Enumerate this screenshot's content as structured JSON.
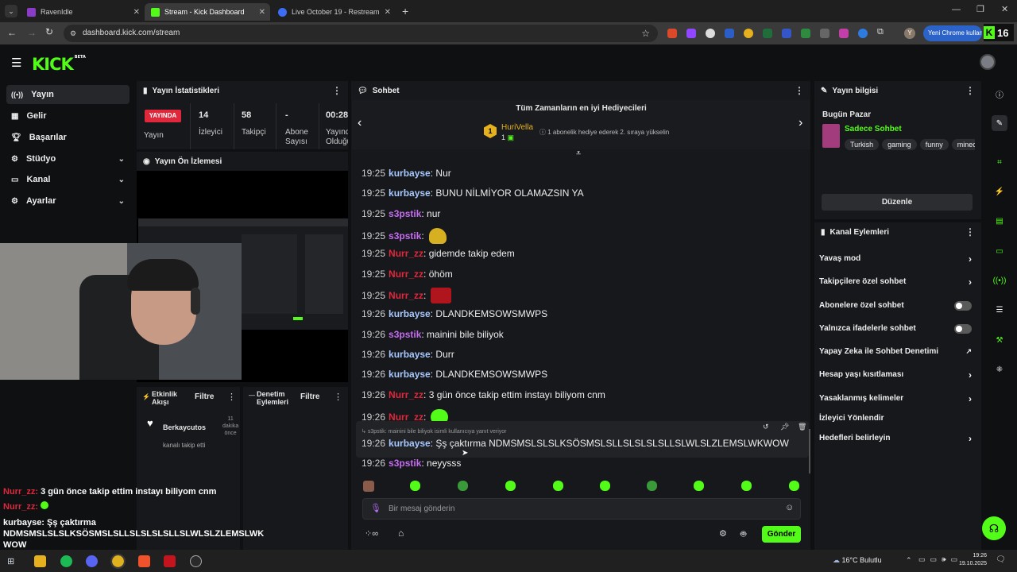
{
  "browser": {
    "tabs": [
      {
        "title": "RavenIdle"
      },
      {
        "title": "Stream - Kick Dashboard"
      },
      {
        "title": "Live October 19 - Restream"
      }
    ],
    "url": "dashboard.kick.com/stream",
    "profile_badge": "Yeni Chrome kullan",
    "kick_badge": "16"
  },
  "kick": {
    "logo": "KICK",
    "beta": "BETA"
  },
  "sidebar": {
    "items": [
      {
        "label": "Yayın",
        "icon": "broadcast-icon"
      },
      {
        "label": "Gelir",
        "icon": "revenue-icon"
      },
      {
        "label": "Başarılar",
        "icon": "trophy-icon"
      },
      {
        "label": "Stüdyo",
        "icon": "studio-icon"
      },
      {
        "label": "Kanal",
        "icon": "channel-icon"
      },
      {
        "label": "Ayarlar",
        "icon": "settings-icon"
      }
    ]
  },
  "stats": {
    "title": "Yayın İstatistikleri",
    "status": "YAYINDA",
    "status_label": "Yayın",
    "viewers": "14",
    "viewers_label": "İzleyici",
    "followers": "58",
    "followers_label": "Takipçi",
    "subs": "-",
    "subs_label1": "Abone",
    "subs_label2": "Sayısı",
    "time": "00:28",
    "time_label1": "Yayında",
    "time_label2": "Olduğu"
  },
  "preview": {
    "title": "Yayın Ön İzlemesi"
  },
  "activity": {
    "title1": "Etkinlik",
    "title2": "Akışı",
    "filter": "Filtre",
    "user": "Berkaycutos",
    "ago1": "11",
    "ago2": "dakika",
    "ago3": "önce",
    "action": "kanalı takip etti"
  },
  "moderation": {
    "title1": "Denetim",
    "title2": "Eylemleri",
    "filter": "Filtre"
  },
  "overlay": {
    "lines": [
      {
        "user": "Nurr_zz:",
        "text": "3 gün önce takip ettim instayı biliyom cnm"
      },
      {
        "user": "Nurr_zz:",
        "text": ""
      },
      {
        "user": "kurbayse:",
        "text": "Şş çaktırma"
      },
      {
        "user": "",
        "text": "NDMSMSLSLSLKSÖSMSLSLLSLSLSLSLLSLWLSLZLEMSLWK"
      },
      {
        "user": "",
        "text": "WOW"
      }
    ]
  },
  "chat": {
    "title": "Sohbet",
    "gifters_title": "Tüm Zamanların en iyi Hediyecileri",
    "gifter_name": "HuriVella",
    "gifter_count": "1",
    "gifter_rank": "1",
    "gifter_note": "1 abonelik hediye ederek 2. sıraya yükselin",
    "messages": [
      {
        "time": "19:25",
        "user": "kurbayse",
        "text": ": Nur"
      },
      {
        "time": "19:25",
        "user": "kurbayse",
        "text": ": BUNU NİLMİYOR OLAMAZSIN YA"
      },
      {
        "time": "19:25",
        "user": "s3pstik",
        "text": ": nur"
      },
      {
        "time": "19:25",
        "user": "s3pstik",
        "text": ":"
      },
      {
        "time": "19:25",
        "user": "Nurr_zz",
        "text": ": gidemde takip edem"
      },
      {
        "time": "19:25",
        "user": "Nurr_zz",
        "text": ": öhöm"
      },
      {
        "time": "19:25",
        "user": "Nurr_zz",
        "text": ":"
      },
      {
        "time": "19:26",
        "user": "kurbayse",
        "text": ": DLANDKEMSOWSMWPS"
      },
      {
        "time": "19:26",
        "user": "s3pstik",
        "text": ": mainini bile biliyok"
      },
      {
        "time": "19:26",
        "user": "kurbayse",
        "text": ": Durr"
      },
      {
        "time": "19:26",
        "user": "kurbayse",
        "text": ": DLANDKEMSOWSMWPS"
      },
      {
        "time": "19:26",
        "user": "Nurr_zz",
        "text": ": 3 gün önce takip ettim instayı biliyom cnm"
      },
      {
        "time": "19:26",
        "user": "Nurr_zz",
        "text": ":"
      },
      {
        "time": "19:26",
        "user": "kurbayse",
        "text": ": Şş çaktırma NDMSMSLSLSLKSÖSMSLSLLSLSLSLSLLSLWLSLZLEMSLWKWOW"
      },
      {
        "time": "19:26",
        "user": "s3pstik",
        "text": ": neyysss"
      }
    ],
    "reply_note": "s3pstik: mainini bile biliyok isimli kullanıcıya yanıt veriyor",
    "input_placeholder": "Bir mesaj gönderin",
    "send": "Gönder"
  },
  "stream_info": {
    "title": "Yayın bilgisi",
    "day": "Bugün Pazar",
    "category": "Sadece Sohbet",
    "tags": [
      "Turkish",
      "gaming",
      "funny",
      "minecra"
    ],
    "edit": "Düzenle"
  },
  "channel_actions": {
    "title": "Kanal Eylemleri",
    "items": [
      {
        "label": "Yavaş mod",
        "kind": "arrow"
      },
      {
        "label": "Takipçilere özel sohbet",
        "kind": "arrow"
      },
      {
        "label": "Abonelere özel sohbet",
        "kind": "toggle",
        "on": false
      },
      {
        "label": "Yalnızca ifadelerle sohbet",
        "kind": "toggle",
        "on": false
      },
      {
        "label": "Yapay Zeka ile Sohbet Denetimi",
        "kind": "external"
      },
      {
        "label": "Hesap yaşı kısıtlaması",
        "kind": "arrow"
      },
      {
        "label": "Yasaklanmış kelimeler",
        "kind": "arrow"
      },
      {
        "label": "İzleyici Yönlendir",
        "kind": "none"
      },
      {
        "label": "Hedefleri belirleyin",
        "kind": "arrow"
      }
    ]
  },
  "taskbar": {
    "weather": "16°C Bulutlu",
    "time": "19:26",
    "date": "19.10.2025"
  },
  "colors": {
    "accent": "#53fc18",
    "live": "#e0283c"
  }
}
